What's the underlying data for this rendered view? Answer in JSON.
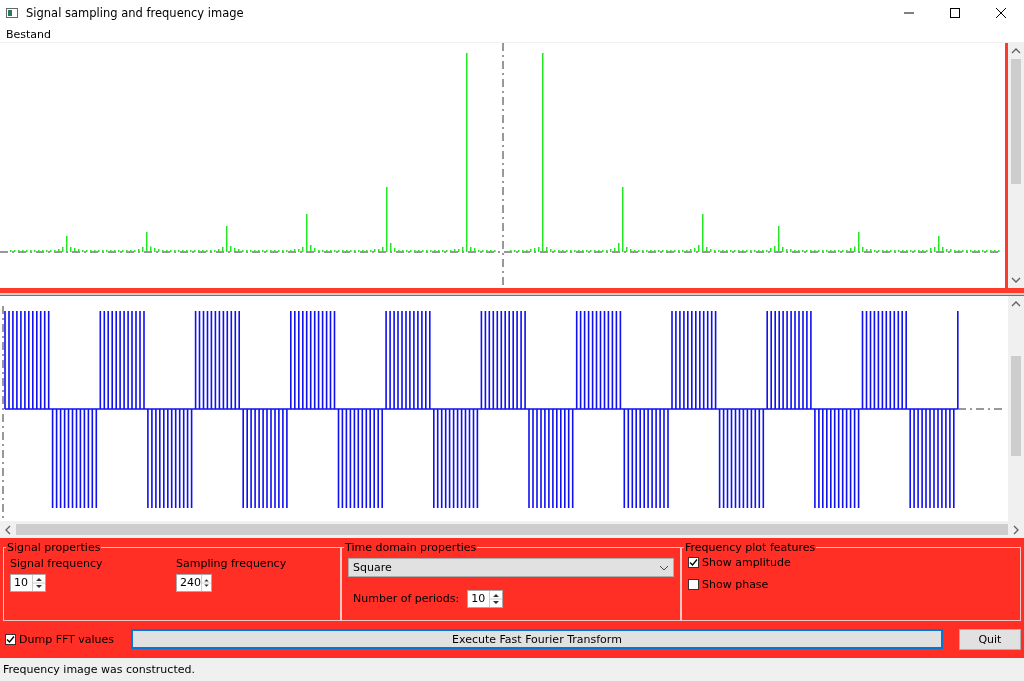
{
  "window": {
    "title": "Signal sampling and frequency image"
  },
  "menu": [
    "Bestand"
  ],
  "signal_properties": {
    "title": "Signal properties",
    "signal_frequency": {
      "label": "Signal frequency",
      "value": "10"
    },
    "sampling_frequency": {
      "label": "Sampling frequency",
      "value": "240"
    }
  },
  "time_domain": {
    "title": "Time domain properties",
    "waveform": "Square",
    "periods": {
      "label": "Number of periods:",
      "value": "10"
    }
  },
  "frequency_plot": {
    "title": "Frequency plot features",
    "options": [
      {
        "label": "Show amplitude",
        "checked": true
      },
      {
        "label": "Show phase",
        "checked": false
      }
    ]
  },
  "dump_fft": {
    "label": "Dump FFT values",
    "checked": true
  },
  "execute_button": "Execute Fast Fourier Transform",
  "quit_button": "Quit",
  "status_bar": "Frequency image was constructed."
}
